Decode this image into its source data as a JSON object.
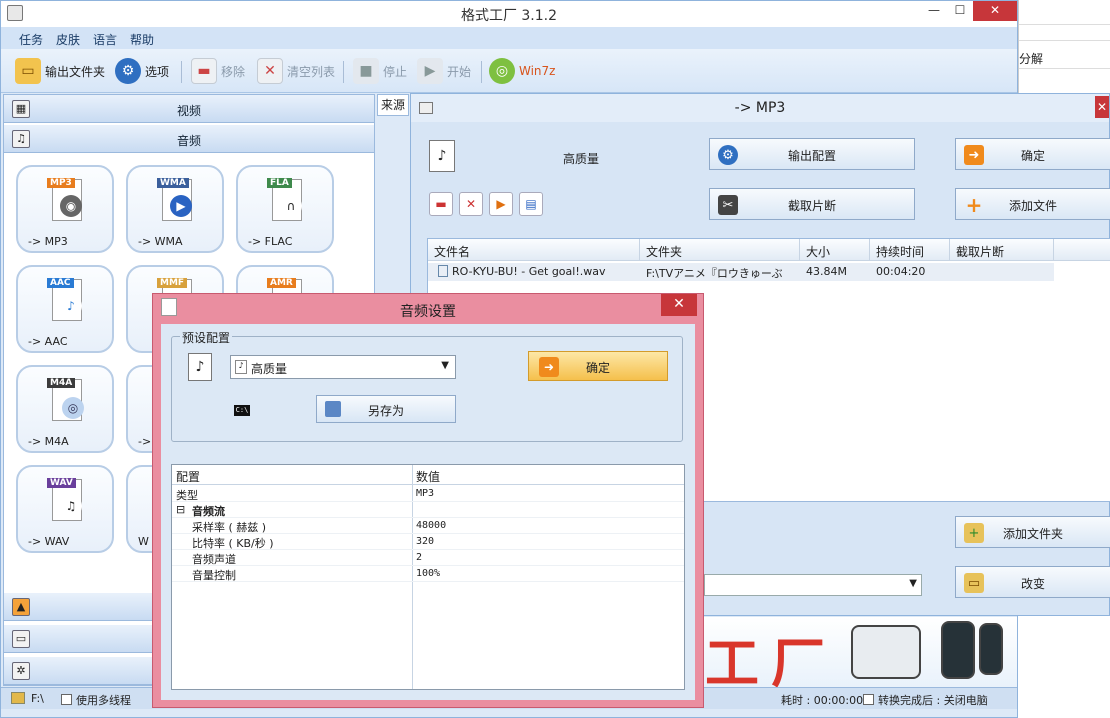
{
  "main_window": {
    "title": "格式工厂 3.1.2",
    "menu": [
      "任务",
      "皮肤",
      "语言",
      "帮助"
    ],
    "toolbar": {
      "output_folder": "输出文件夹",
      "options": "选项",
      "remove": "移除",
      "clear_list": "清空列表",
      "stop": "停止",
      "start": "开始",
      "win7z": "Win7z"
    },
    "categories": {
      "video": "视频",
      "audio": "音频"
    },
    "formats": [
      {
        "badge": "MP3",
        "label": "-> MP3"
      },
      {
        "badge": "WMA",
        "label": "-> WMA"
      },
      {
        "badge": "FLA",
        "label": "-> FLAC"
      },
      {
        "badge": "AAC",
        "label": "-> AAC"
      },
      {
        "badge": "MMF",
        "label": ""
      },
      {
        "badge": "AMR",
        "label": ""
      },
      {
        "badge": "M4A",
        "label": "-> M4A"
      },
      {
        "badge": "",
        "label": "->"
      },
      {
        "badge": "WAV",
        "label": "-> WAV"
      },
      {
        "badge": "",
        "label": "W"
      }
    ],
    "source_tab": "来源",
    "status": {
      "drive": "F:\\",
      "multithread": "使用多线程",
      "elapsed": "耗时 : 00:00:00",
      "after_complete": "转换完成后 : 关闭电脑"
    },
    "banner_text": "工厂",
    "right_window_fragment": "分解"
  },
  "mp3_dialog": {
    "title": "-> MP3",
    "quality": "高质量",
    "buttons": {
      "output_config": "输出配置",
      "ok": "确定",
      "clip": "截取片断",
      "add_file": "添加文件",
      "add_folder": "添加文件夹",
      "change": "改变"
    },
    "table": {
      "headers": [
        "文件名",
        "文件夹",
        "大小",
        "持续时间",
        "截取片断"
      ],
      "rows": [
        {
          "name": "RO-KYU-BU! - Get goal!.wav",
          "folder": "F:\\TVアニメ『ロウきゅーぶ",
          "size": "43.84M",
          "duration": "00:04:20",
          "clip": ""
        }
      ]
    }
  },
  "audio_dialog": {
    "title": "音频设置",
    "preset_group": "预设配置",
    "preset_value": "高质量",
    "ok": "确定",
    "save_as": "另存为",
    "grid_headers": [
      "配置",
      "数值"
    ],
    "rows": [
      {
        "key": "类型",
        "value": "MP3",
        "indent": false
      },
      {
        "key": "音频流",
        "value": "",
        "indent": false,
        "group": true
      },
      {
        "key": "采样率 ( 赫兹 )",
        "value": "48000",
        "indent": true
      },
      {
        "key": "比特率 ( KB/秒 )",
        "value": "320",
        "indent": true
      },
      {
        "key": "音频声道",
        "value": "2",
        "indent": true
      },
      {
        "key": "音量控制",
        "value": "100%",
        "indent": true
      }
    ]
  },
  "colors": {
    "accent_blue": "#dde9f7",
    "dialog_pink": "#ea8ea0",
    "close_red": "#c7363a",
    "ok_orange": "#f5c04c"
  }
}
